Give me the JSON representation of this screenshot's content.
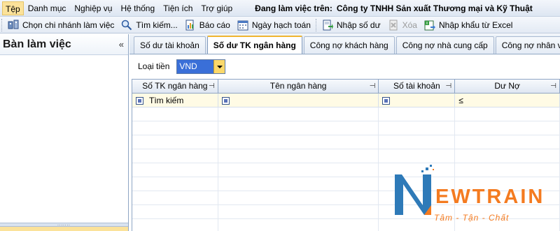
{
  "menubar": {
    "items": [
      {
        "label": "Tệp",
        "active": true
      },
      {
        "label": "Danh mục"
      },
      {
        "label": "Nghiệp vụ"
      },
      {
        "label": "Hệ thống"
      },
      {
        "label": "Tiện ích"
      },
      {
        "label": "Trợ giúp"
      }
    ],
    "working_on_label": "Đang làm việc trên:",
    "company_name": "Công ty TNHH Sản xuất Thương mại và Kỹ Thuật"
  },
  "toolbar": {
    "items": [
      {
        "label": "Chọn chi nhánh làm việc",
        "icon": "branch-icon"
      },
      {
        "label": "Tìm kiếm...",
        "icon": "search-icon"
      },
      {
        "label": "Báo cáo",
        "icon": "report-icon"
      },
      {
        "label": "Ngày hạch toán",
        "icon": "calendar-icon"
      },
      {
        "label": "Nhập số dư",
        "icon": "import-balance-icon"
      },
      {
        "label": "Xóa",
        "icon": "delete-icon",
        "disabled": true
      },
      {
        "label": "Nhập khẩu từ Excel",
        "icon": "excel-import-icon"
      }
    ]
  },
  "leftpanel": {
    "title": "Bàn làm việc",
    "collapse_glyph": "«"
  },
  "tabs": [
    {
      "label": "Số dư tài khoản"
    },
    {
      "label": "Số dư TK ngân hàng",
      "active": true
    },
    {
      "label": "Công nợ khách hàng"
    },
    {
      "label": "Công nợ nhà cung cấp"
    },
    {
      "label": "Công nợ nhân viên"
    }
  ],
  "filter": {
    "currency_label": "Loại tiền",
    "currency_value": "VND"
  },
  "grid": {
    "columns": [
      "Số TK ngân hàng",
      "Tên ngân hàng",
      "Số tài khoản",
      "Dư Nợ"
    ],
    "filter_row": {
      "search_text": "Tìm kiếm",
      "operator": "≤"
    }
  },
  "logo": {
    "brand_first": "N",
    "brand_rest": "EWTRAIN",
    "tagline": "Tâm - Tận - Chất"
  },
  "colors": {
    "accent_blue": "#3a6fd8",
    "highlight_yellow": "#fbe29a",
    "logo_blue": "#2e7ab8",
    "logo_orange": "#f47b20"
  }
}
